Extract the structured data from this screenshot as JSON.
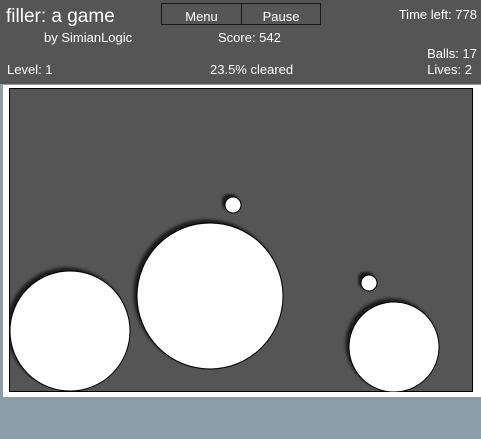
{
  "header": {
    "title": "filler: a game",
    "byline": "by SimianLogic",
    "menu_label": "Menu",
    "pause_label": "Pause",
    "score_text": "Score: 542",
    "time_text": "Time left: 778",
    "balls_text": "Balls: 17",
    "level_text": "Level: 1",
    "cleared_text": "23.5% cleared",
    "lives_text": "Lives: 2"
  },
  "colors": {
    "hud_background": "#555555",
    "field_background": "#555555",
    "filled_circle": "#ffffff",
    "bouncing_ball": "#ffffff",
    "outline": "#000000",
    "footer": "#8a9fa8"
  }
}
